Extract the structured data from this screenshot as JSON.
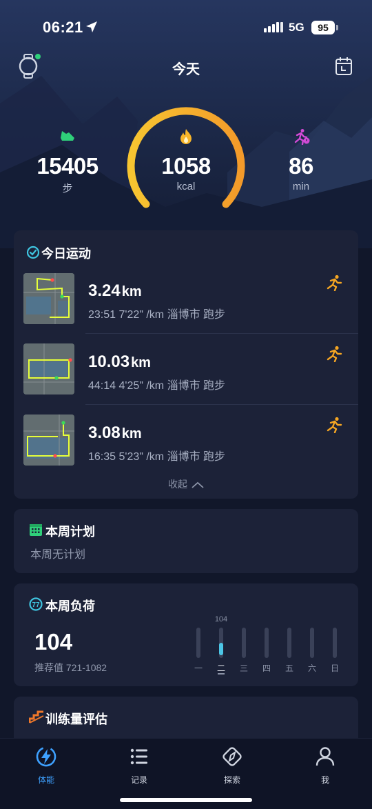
{
  "status_bar": {
    "time": "06:21",
    "network": "5G",
    "battery": "95"
  },
  "header": {
    "title": "今天"
  },
  "stats": {
    "steps": {
      "value": "15405",
      "unit": "步"
    },
    "calories": {
      "value": "1058",
      "unit": "kcal"
    },
    "minutes": {
      "value": "86",
      "unit": "min"
    },
    "calorie_goal_progress": 1.0
  },
  "today_activities": {
    "title": "今日运动",
    "items": [
      {
        "distance": "3.24",
        "unit": "km",
        "meta": "23:51  7'22\" /km 淄博市 跑步",
        "icon": "running-icon"
      },
      {
        "distance": "10.03",
        "unit": "km",
        "meta": "44:14  4'25\" /km 淄博市 跑步",
        "icon": "running-icon"
      },
      {
        "distance": "3.08",
        "unit": "km",
        "meta": "16:35  5'23\" /km 淄博市 跑步",
        "icon": "running-icon"
      }
    ],
    "collapse_label": "收起"
  },
  "weekly_plan": {
    "title": "本周计划",
    "subtitle": "本周无计划"
  },
  "weekly_load": {
    "title": "本周负荷",
    "value": "104",
    "recommended": "推荐值 721-1082",
    "days": [
      "一",
      "二",
      "三",
      "四",
      "五",
      "六",
      "日"
    ],
    "day_values": [
      0,
      104,
      0,
      0,
      0,
      0,
      0
    ],
    "peak_label": "104",
    "current_day_index": 1,
    "accent": "#4cc6e6"
  },
  "training_eval": {
    "title": "训练量评估"
  },
  "tabs": [
    {
      "label": "体能",
      "icon": "energy-icon",
      "active": true
    },
    {
      "label": "记录",
      "icon": "list-icon",
      "active": false
    },
    {
      "label": "探索",
      "icon": "compass-icon",
      "active": false
    },
    {
      "label": "我",
      "icon": "user-icon",
      "active": false
    }
  ],
  "colors": {
    "accent_blue": "#3ea1ff",
    "gauge_start": "#f7c531",
    "gauge_end": "#f39a2a",
    "steps_green": "#2fd07a",
    "minutes_pink": "#d24bd6",
    "run_orange": "#f5a623"
  }
}
